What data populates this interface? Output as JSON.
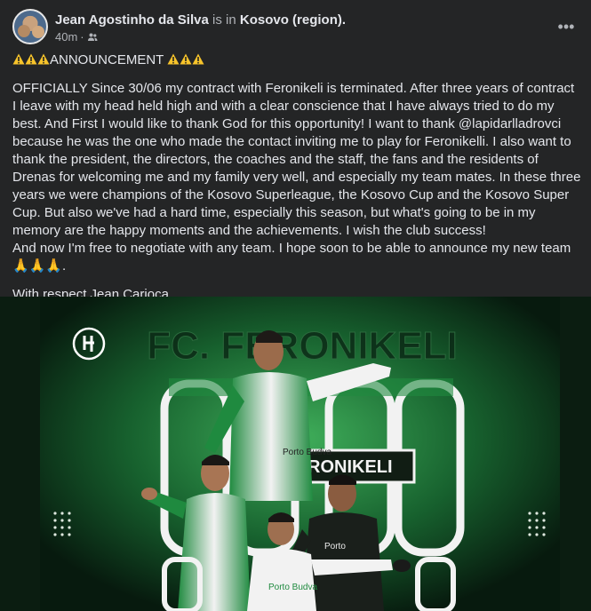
{
  "post": {
    "author": "Jean Agostinho da Silva",
    "is_in_text": "is in",
    "location": "Kosovo (region).",
    "time": "40m",
    "separator": "·",
    "privacy_icon": "friends-icon",
    "more_icon": "more-horizontal-icon"
  },
  "body": {
    "headline": "ANNOUNCEMENT",
    "paragraph": "OFFICIALLY Since 30/06 my contract with Feronikeli is terminated. After three years of contract I leave with my head held high and with a clear conscience that I have always tried to do my best. And First I would like to thank God for this opportunity! I want to thank @lapidarlladrovci because he was the one who made the contact inviting me to play for Feronikelli. I also want to thank the president, the directors, the coaches and the staff, the fans and the residents of Drenas for welcoming me and my family very well, and especially my team mates. In these three years we were champions of the Kosovo Superleague, the Kosovo Cup and the Kosovo Super Cup. But also we've had a hard time, especially this season, but what's going to be in my memory are the happy moments and the achievements. I wish the club success!",
    "free_line": "And now I'm free to negotiate with any team. I hope soon to be able to announce my new team",
    "hands": "🙏🙏🙏",
    "hands_tail": ".",
    "signoff": "With respect Jean Carioca."
  },
  "image": {
    "club_header": "FC. FERONIKELI",
    "center_badge": "FERONIKELI",
    "sponsor": "Porto Budva",
    "sponsor2": "Porto",
    "colors": {
      "green": "#1f8a3f",
      "dark": "#0e2416",
      "white": "#f2f2f2"
    }
  }
}
